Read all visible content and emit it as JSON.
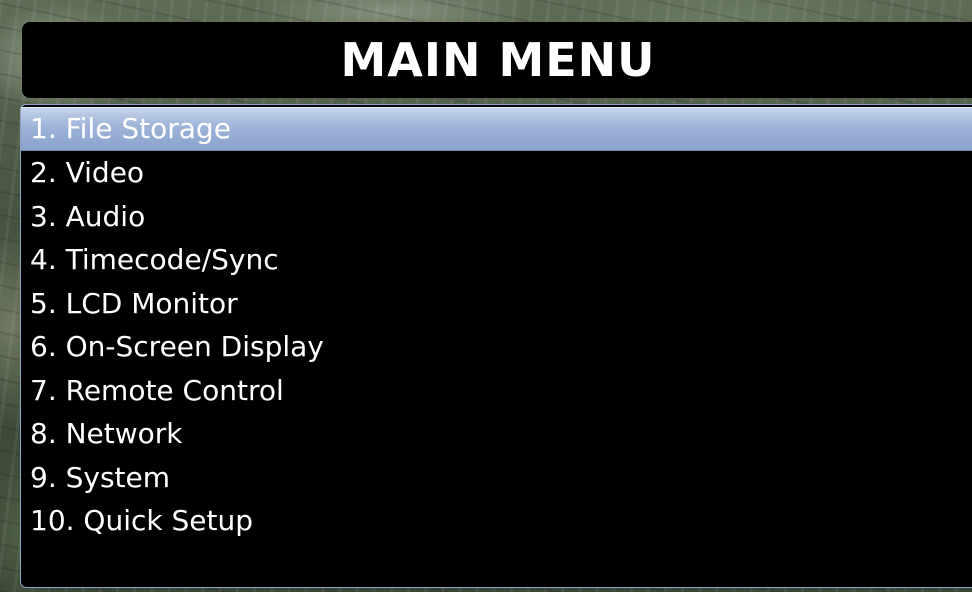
{
  "title": "MAIN MENU",
  "menu": {
    "selected_index": 0,
    "selected_color": "#9db3d8",
    "items": [
      {
        "label": "1. File Storage"
      },
      {
        "label": "2. Video"
      },
      {
        "label": "3. Audio"
      },
      {
        "label": "4. Timecode/Sync"
      },
      {
        "label": "5. LCD Monitor"
      },
      {
        "label": "6. On-Screen Display"
      },
      {
        "label": "7. Remote Control"
      },
      {
        "label": "8. Network"
      },
      {
        "label": "9. System"
      },
      {
        "label": "10. Quick Setup"
      }
    ]
  }
}
